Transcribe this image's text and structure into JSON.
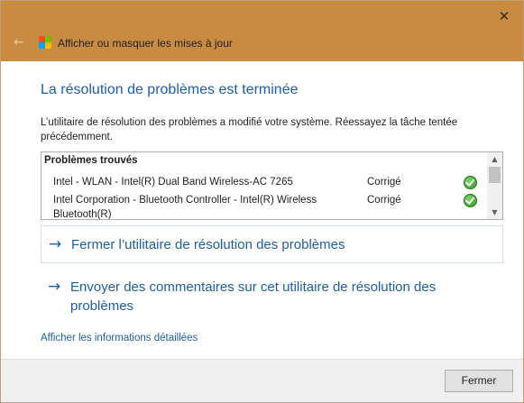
{
  "window": {
    "title": "Afficher ou masquer les mises à jour",
    "close_glyph": "✕",
    "back_glyph": "←"
  },
  "heading": "La résolution de problèmes est terminée",
  "description": "L’utilitaire de résolution des problèmes a modifié votre système. Réessayez la tâche tentée précédemment.",
  "results": {
    "header": "Problèmes trouvés",
    "rows": [
      {
        "name": "Intel - WLAN - Intel(R) Dual Band Wireless-AC 7265",
        "status": "Corrigé",
        "icon": "check-icon"
      },
      {
        "name": "Intel Corporation - Bluetooth Controller - Intel(R) Wireless Bluetooth(R)",
        "status": "Corrigé",
        "icon": "check-icon"
      }
    ]
  },
  "actions": [
    {
      "label": "Fermer l’utilitaire de résolution des problèmes",
      "icon": "arrow-right-icon",
      "arrow": "→"
    },
    {
      "label": "Envoyer des commentaires sur cet utilitaire de résolution des problèmes",
      "icon": "arrow-right-icon",
      "arrow": "→"
    }
  ],
  "details_link": "Afficher les informations détaillées",
  "footer": {
    "close_label": "Fermer"
  },
  "colors": {
    "titlebar": "#c98a42",
    "accent_blue": "#1d5ea8",
    "check_green": "#2d8f24",
    "logo_red": "#f25022",
    "logo_green": "#7fba00",
    "logo_blue": "#00a4ef",
    "logo_yellow": "#ffb900"
  }
}
